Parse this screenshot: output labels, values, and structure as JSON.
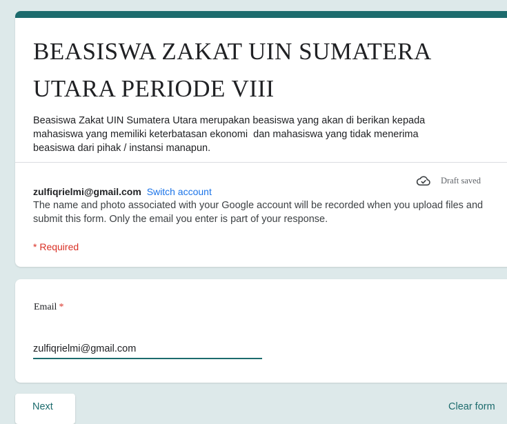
{
  "form": {
    "title": "BEASISWA ZAKAT UIN SUMATERA UTARA PERIODE VIII",
    "description": "Beasiswa Zakat UIN Sumatera Utara merupakan beasiswa yang akan di berikan kepada\nmahasiswa yang memiliki keterbatasan ekonomi  dan mahasiswa yang tidak menerima\nbeasiswa dari pihak / instansi manapun.",
    "accent_color": "#1c6b6d"
  },
  "account": {
    "email": "zulfiqrielmi@gmail.com",
    "switch_label": "Switch account",
    "draft_status": "Draft saved",
    "draft_icon": "cloud-check-icon",
    "notice": "The name and photo associated with your Google account will be recorded when you upload files and submit this form. Only the email you enter is part of your response.",
    "required_note": "* Required"
  },
  "email_question": {
    "label": "Email",
    "required_mark": "*",
    "value": "zulfiqrielmi@gmail.com"
  },
  "footer": {
    "next_label": "Next",
    "clear_label": "Clear form"
  },
  "colors": {
    "background": "#dde9ea",
    "accent": "#1c6b6d",
    "link": "#1a73e8",
    "required": "#d93025"
  }
}
